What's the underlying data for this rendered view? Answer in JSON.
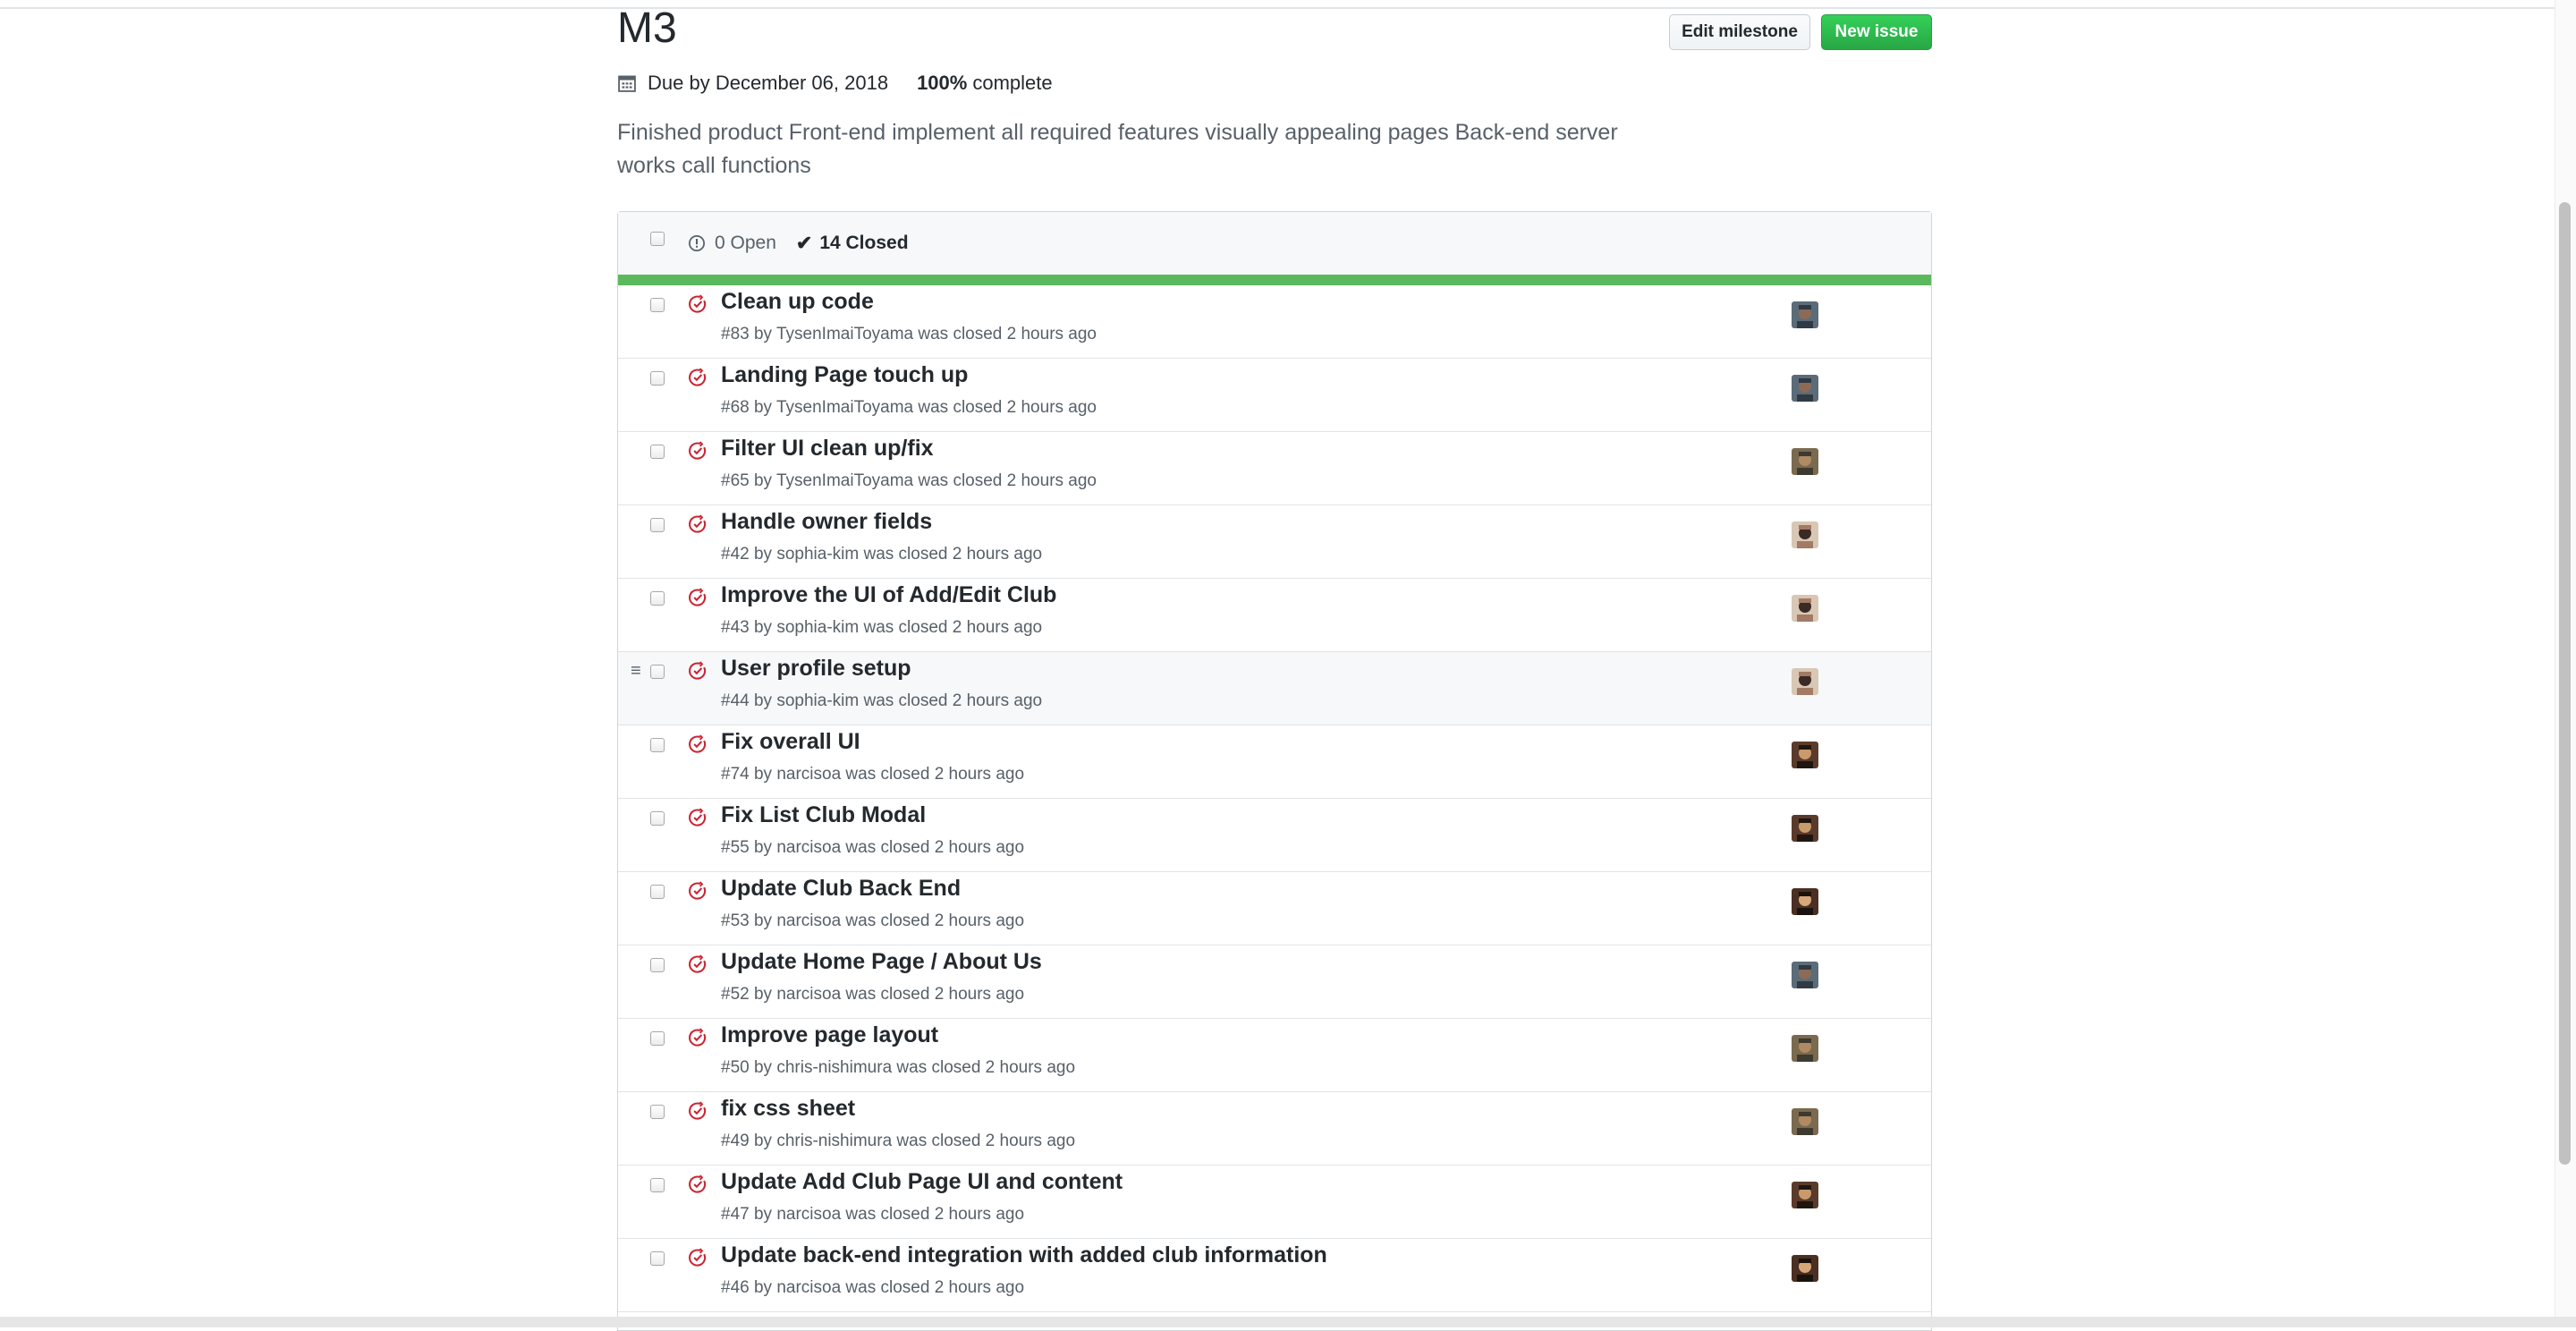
{
  "milestone": {
    "title": "M3",
    "due": "Due by December 06, 2018",
    "percent": "100%",
    "complete_label": "complete",
    "description": "Finished product Front-end implement all required features visually appealing pages Back-end server works call functions",
    "progress": 1.0
  },
  "actions": {
    "edit_label": "Edit milestone",
    "new_label": "New issue"
  },
  "states": {
    "open": "0 Open",
    "closed": "14 Closed"
  },
  "colors": {
    "new_button": "#28a745",
    "progress_bar": "#5cb85c",
    "closed_icon": "#cb2431"
  },
  "issues": [
    {
      "title": "Clean up code",
      "meta": "#83 by TysenImaiToyama was closed 2 hours ago",
      "avatar": "avatar-a"
    },
    {
      "title": "Landing Page touch up",
      "meta": "#68 by TysenImaiToyama was closed 2 hours ago",
      "avatar": "avatar-a"
    },
    {
      "title": "Filter UI clean up/fix",
      "meta": "#65 by TysenImaiToyama was closed 2 hours ago",
      "avatar": "avatar-c"
    },
    {
      "title": "Handle owner fields",
      "meta": "#42 by sophia-kim was closed 2 hours ago",
      "avatar": "avatar-s"
    },
    {
      "title": "Improve the UI of Add/Edit Club",
      "meta": "#43 by sophia-kim was closed 2 hours ago",
      "avatar": "avatar-s"
    },
    {
      "title": "User profile setup",
      "meta": "#44 by sophia-kim was closed 2 hours ago",
      "avatar": "avatar-s",
      "highlighted": true
    },
    {
      "title": "Fix overall UI",
      "meta": "#74 by narcisoa was closed 2 hours ago",
      "avatar": "avatar-n"
    },
    {
      "title": "Fix List Club Modal",
      "meta": "#55 by narcisoa was closed 2 hours ago",
      "avatar": "avatar-n"
    },
    {
      "title": "Update Club Back End",
      "meta": "#53 by narcisoa was closed 2 hours ago",
      "avatar": "avatar-n2"
    },
    {
      "title": "Update Home Page / About Us",
      "meta": "#52 by narcisoa was closed 2 hours ago",
      "avatar": "avatar-a"
    },
    {
      "title": "Improve page layout",
      "meta": "#50 by chris-nishimura was closed 2 hours ago",
      "avatar": "avatar-c"
    },
    {
      "title": "fix css sheet",
      "meta": "#49 by chris-nishimura was closed 2 hours ago",
      "avatar": "avatar-c"
    },
    {
      "title": "Update Add Club Page UI and content",
      "meta": "#47 by narcisoa was closed 2 hours ago",
      "avatar": "avatar-n"
    },
    {
      "title": "Update back-end integration with added club information",
      "meta": "#46 by narcisoa was closed 2 hours ago",
      "avatar": "avatar-n2"
    }
  ]
}
